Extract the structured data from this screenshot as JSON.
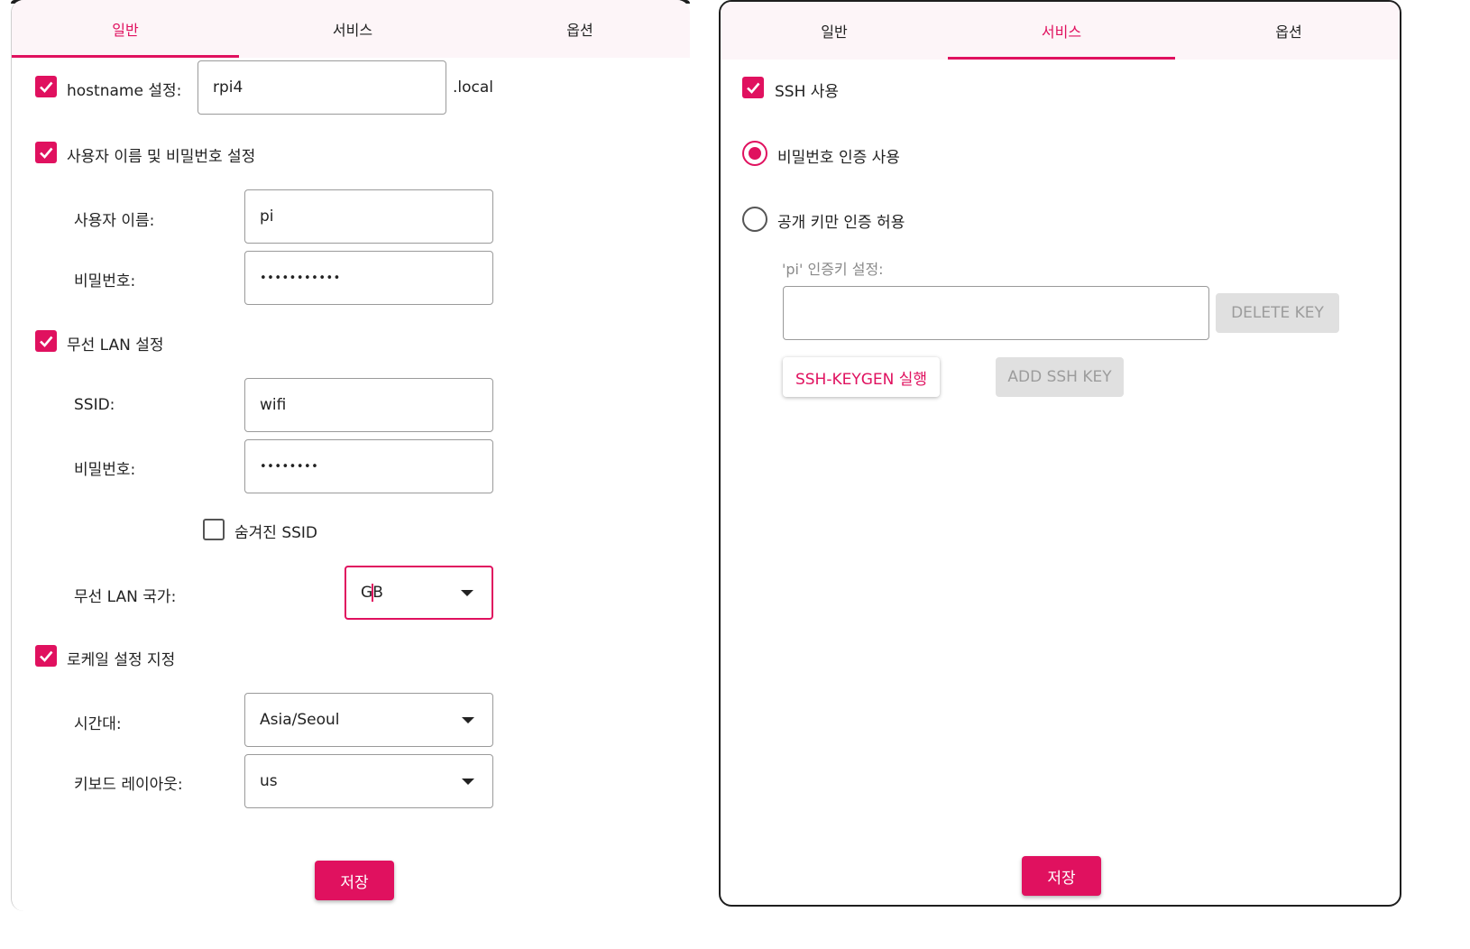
{
  "colors": {
    "accent": "#e0115f",
    "tab_bar_bg": "#fdf5f8",
    "disabled_button_bg": "#e0e0e0",
    "disabled_text": "#9c9c9c"
  },
  "tabs": [
    {
      "label": "일반"
    },
    {
      "label": "서비스"
    },
    {
      "label": "옵션"
    }
  ],
  "general": {
    "active_tab": "일반",
    "hostname": {
      "checked": true,
      "label": "hostname 설정:",
      "value": "rpi4",
      "suffix": ".local"
    },
    "user": {
      "checked": true,
      "label": "사용자 이름 및 비밀번호 설정",
      "username_label": "사용자 이름:",
      "username_value": "pi",
      "password_label": "비밀번호:",
      "password_value": "•••••••••••"
    },
    "wifi": {
      "checked": true,
      "label": "무선 LAN 설정",
      "ssid_label": "SSID:",
      "ssid_value": "wifi",
      "password_label": "비밀번호:",
      "password_value": "••••••••",
      "hidden_ssid_checked": false,
      "hidden_ssid_label": "숨겨진 SSID",
      "country_label": "무선 LAN 국가:",
      "country_value_before_cursor": "G",
      "country_value_after_cursor": "B"
    },
    "locale": {
      "checked": true,
      "label": "로케일 설정 지정",
      "timezone_label": "시간대:",
      "timezone_value": "Asia/Seoul",
      "keyboard_label": "키보드 레이아웃:",
      "keyboard_value": "us"
    },
    "save_label": "저장"
  },
  "services": {
    "active_tab": "서비스",
    "ssh": {
      "checked": true,
      "label": "SSH 사용"
    },
    "password_auth": {
      "selected": true,
      "label": "비밀번호 인증 사용"
    },
    "pubkey_auth": {
      "selected": false,
      "label": "공개 키만 인증 허용"
    },
    "authkey_label": "'pi' 인증키 설정:",
    "authkey_value": "",
    "delete_key_label": "DELETE KEY",
    "keygen_label": "SSH-KEYGEN 실행",
    "add_key_label": "ADD SSH KEY",
    "save_label": "저장"
  }
}
